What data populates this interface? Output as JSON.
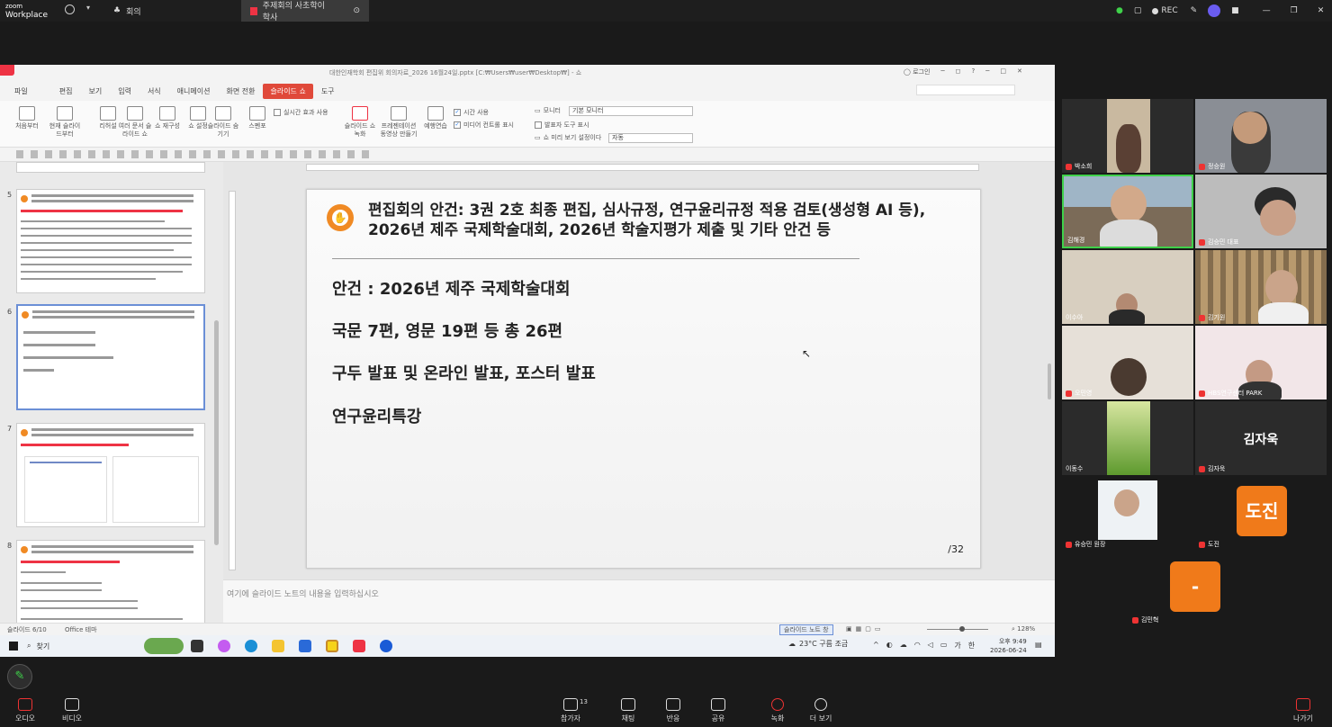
{
  "zoom": {
    "logo_line1": "zoom",
    "logo_line2": "Workplace",
    "tab1_label": "회의",
    "tab2_label": "주제회의 사초학이 학사",
    "rec_label": "REC"
  },
  "ppt": {
    "window_title": "대한인재학회 편집위 회의자료_2026 16월24일.pptx [C:₩Users₩user₩Desktop₩] - 쇼",
    "login_label": "로그인",
    "menu": [
      "파일",
      "편집",
      "보기",
      "입력",
      "서식",
      "애니메이션",
      "화면 전환",
      "슬라이드 쇼",
      "도구"
    ],
    "active_menu": "슬라이드 쇼",
    "ribbon": {
      "btn_from_start": "처음부터",
      "btn_current": "현재 슬라이드부터",
      "btn_rehearse": "리허설",
      "btn_custom": "여러 문서 슬라이드 쇼",
      "btn_show_setup": "쇼 재구성",
      "btn_check": "쇼 설정",
      "btn_hide": "슬라이드 숨기기",
      "btn_pen": "스펜포",
      "chk_realtime": "실시간 효과 사용",
      "chk_time": "시간 사용",
      "chk_media": "미디어 컨트롤 표시",
      "btn_record": "슬라이드 쇼 녹화",
      "btn_presenter": "프레젠테이션 동영상 만들기",
      "btn_rehearse2": "예행연습",
      "lbl_monitor": "모니터",
      "sel_monitor": "기본 모니터",
      "chk_presenter_tools": "발표자 도구 표시",
      "lbl_show_settings": "쇼 미리 보기 설정이다",
      "sel_auto": "자동"
    },
    "thumbs": [
      {
        "num": "5"
      },
      {
        "num": "6"
      },
      {
        "num": "7"
      },
      {
        "num": "8"
      }
    ],
    "slide": {
      "title": "편집회의 안건: 3권 2호 최종 편집, 심사규정, 연구윤리규정 적용 검토(생성형 AI 등), 2026년 제주 국제학술대회,  2026년 학술지평가 제출 및 기타 안건 등",
      "line1": "안건 : 2026년 제주 국제학술대회",
      "line2": "국문 7편, 영문 19편 등 총 26편",
      "line3": "구두 발표 및 온라인 발표, 포스터 발표",
      "line4": "연구윤리특강",
      "page_num": "/32"
    },
    "notes_placeholder": "여기에 슬라이드 노트의 내용을 입력하십시오",
    "status": {
      "slide_pos": "슬라이드 6/10",
      "theme": "Office 테마",
      "notes_btn": "슬라이드 노트 창",
      "zoom": "128%"
    }
  },
  "taskbar": {
    "search": "찾기",
    "weather": "23°C  구름 조금",
    "lang": "가",
    "ime": "한",
    "time": "오후 9:49",
    "date": "2026-06-24"
  },
  "gallery": {
    "tiles": [
      {
        "name": "박소희"
      },
      {
        "name": "정승원"
      },
      {
        "name": "김해경"
      },
      {
        "name": "김승민 대표"
      },
      {
        "name": "이수아"
      },
      {
        "name": "김기원"
      },
      {
        "name": "오민영"
      },
      {
        "name": "HBS연구센터 PARK"
      },
      {
        "name": "이동수"
      },
      {
        "name": "김자욱"
      },
      {
        "name": "유승민 원장"
      },
      {
        "name": "도진"
      },
      {
        "name": "김민혁"
      }
    ],
    "big_name": "김자욱",
    "avatar_dojin": "도진",
    "avatar_dash": "-"
  },
  "zoom_controls": {
    "mute": "오디오",
    "video": "비디오",
    "participants": "참가자",
    "participants_count": "13",
    "chat": "채팅",
    "react": "반응",
    "share": "공유",
    "record": "녹화",
    "more": "더 보기",
    "leave": "나가기"
  }
}
